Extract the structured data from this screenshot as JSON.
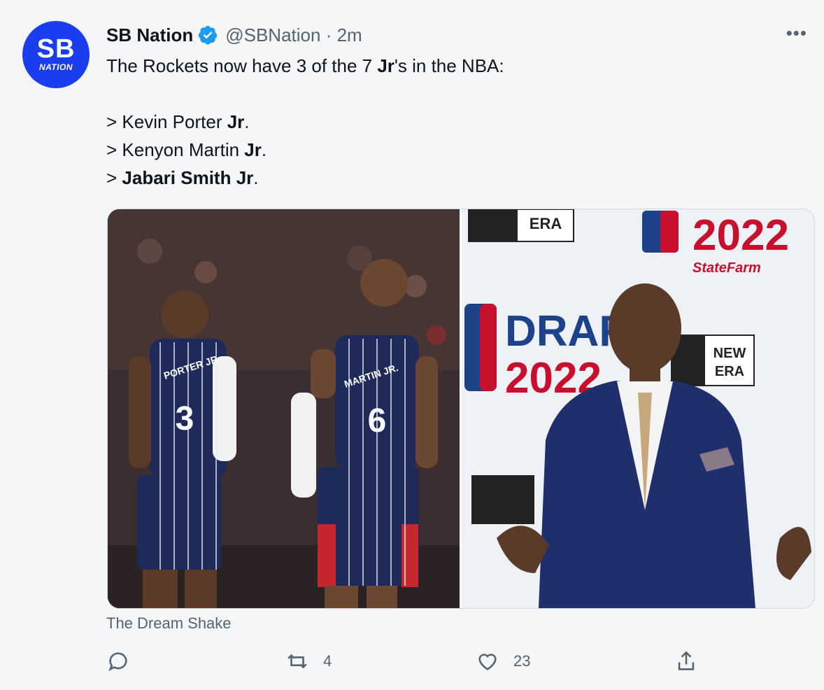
{
  "author": {
    "avatar_text_top": "SB",
    "avatar_text_bottom": "NATION",
    "name": "SB Nation",
    "handle_time": "@SBNation · 2m",
    "verified_color": "#1d9bf0",
    "brand_color": "#1a3df0"
  },
  "menu_label": "•••",
  "tweet": {
    "line1_a": "The Rockets now have 3 of the 7 ",
    "line1_b": "Jr",
    "line1_c": "'s in the NBA:",
    "item1_a": "> Kevin Porter ",
    "item1_b": "Jr",
    "item1_c": ".",
    "item2_a": "> Kenyon Martin ",
    "item2_b": "Jr",
    "item2_c": ".",
    "item3_a": "> ",
    "item3_b": "Jabari Smith Jr",
    "item3_c": "."
  },
  "media": {
    "left_jersey_1_name": "PORTER JR.",
    "left_jersey_1_number": "3",
    "left_jersey_2_name": "MARTIN JR.",
    "left_jersey_2_number": "6",
    "right_brand_1": "NEW",
    "right_brand_2": "ERA",
    "right_draft": "DRAFT",
    "right_year": "2022",
    "right_sponsor": "StateFarm",
    "right_nba": "NBA"
  },
  "source": "The Dream Shake",
  "actions": {
    "reply_count": "",
    "retweet_count": "4",
    "like_count": "23"
  }
}
